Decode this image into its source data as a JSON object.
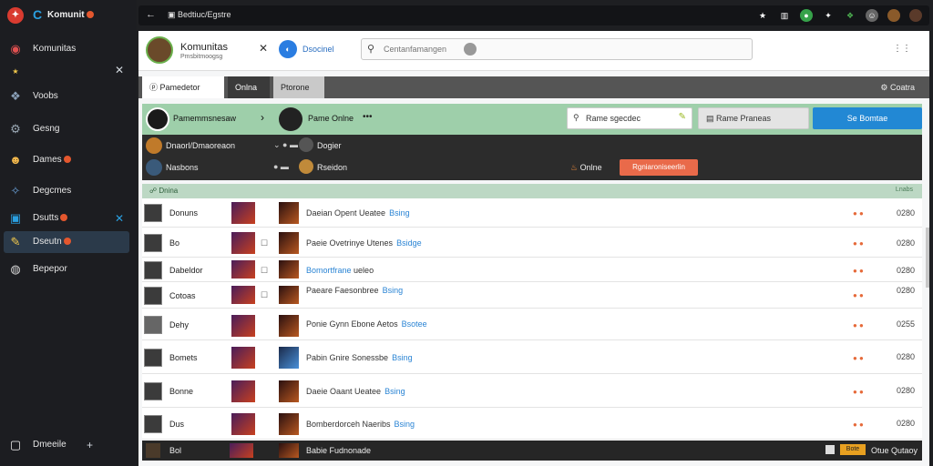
{
  "window": {
    "app_title": "Komunit",
    "tab_title": "Komunitas"
  },
  "sidebar": {
    "items": [
      {
        "label": "Komunitas",
        "icon": "community-icon"
      },
      {
        "label": "Voobs",
        "icon": "bird-icon"
      },
      {
        "label": "Gesng",
        "icon": "gear-icon"
      },
      {
        "label": "Dames",
        "icon": "face-icon"
      },
      {
        "label": "Degcmes",
        "icon": "wing-icon"
      },
      {
        "label": "Dsutts",
        "icon": "chat-icon"
      },
      {
        "label": "Dseutn",
        "icon": "pencil-icon"
      },
      {
        "label": "Bepepor",
        "icon": "world-icon"
      }
    ],
    "footer_label": "Dmeeile"
  },
  "topbar": {
    "title": "Bedtiuc/Egstre"
  },
  "header": {
    "title": "Komunitas",
    "subtitle": "Pmsbitmoogsg",
    "badge_text": "Dsocinel",
    "search_placeholder": "Centanfamangen"
  },
  "tabs": [
    {
      "label": "Pamedetor"
    },
    {
      "label": "Onlna"
    },
    {
      "label": "Ptorone"
    }
  ],
  "tabs_right": "Coatra",
  "profile_bar": {
    "user_left": "Pamemmsnesaw",
    "user_right": "Pame Onlne",
    "input_text": "Rame sgecdec",
    "button_gray": "Rame Praneas",
    "button_blue": "Se Bomtae"
  },
  "dark_rows": [
    {
      "left": "Dnaorl/Dmaoreaon",
      "mid": "Dogier",
      "right": "",
      "action": ""
    },
    {
      "left": "Nasbons",
      "mid": "Rseidon",
      "right": "Onlne",
      "action": "Rgniaroniseerlin"
    }
  ],
  "section": {
    "left": "Dnina",
    "right": "Lnabs"
  },
  "rows": [
    {
      "name": "Donuns",
      "desc": "Daeian Opent Ueatee",
      "link": "Bsing",
      "value": "0280"
    },
    {
      "name": "Bo",
      "desc": "Paeie Ovetrinye Utenes",
      "link": "Bsidge",
      "value": "0280"
    },
    {
      "name": "Dabeldor",
      "desc": "Bomortfrane",
      "link": "ueleo",
      "value": "0280"
    },
    {
      "name": "Cotoas",
      "desc": "Paeare Faesonbree",
      "link": "Bsing",
      "value": "0280"
    },
    {
      "name": "Dehy",
      "desc": "Ponie Gynn Ebone Aetos",
      "link": "Bsotee",
      "value": "0255"
    },
    {
      "name": "Bomets",
      "desc": "Pabin Gnire Sonessbe",
      "link": "Bsing",
      "value": "0280"
    },
    {
      "name": "Bonne",
      "desc": "Daeie Oaant Ueatee",
      "link": "Bsing",
      "value": "0280"
    },
    {
      "name": "Dus",
      "desc": "Bomberdorceh Naeribs",
      "link": "Bsing",
      "value": "0280"
    }
  ],
  "footer_row": {
    "name": "Bol",
    "desc": "Babie Fudnonade",
    "badge": "Bote",
    "right": "Otue Qutaoy"
  },
  "colors": {
    "accent": "#2288d4",
    "green_bar": "#9ecfaa",
    "danger": "#e96a4a",
    "sidebar_bg": "#1c1d21"
  }
}
